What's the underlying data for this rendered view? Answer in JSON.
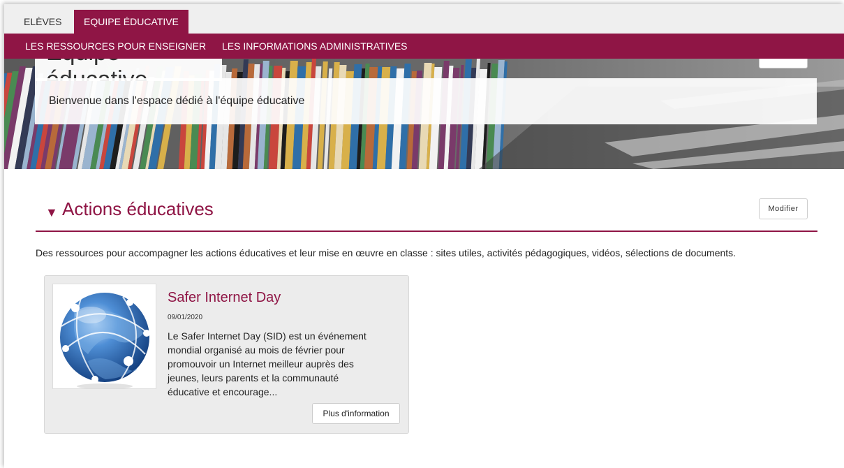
{
  "tabs": [
    {
      "label": "ELÈVES",
      "active": false
    },
    {
      "label": "EQUIPE ÉDUCATIVE",
      "active": true
    }
  ],
  "subnav": [
    {
      "label": "LES RESSOURCES POUR ENSEIGNER"
    },
    {
      "label": "LES INFORMATIONS ADMINISTRATIVES"
    }
  ],
  "banner": {
    "title": "Équipe éducative",
    "welcome": "Bienvenue dans l'espace dédié à l'équipe éducative"
  },
  "section": {
    "title": "Actions éducatives",
    "modify_label": "Modifier",
    "description": "Des ressources pour accompagner les actions éducatives et leur mise en œuvre en classe : sites utiles, activités pédagogiques, vidéos,  sélections de documents."
  },
  "card": {
    "title": "Safer Internet Day",
    "date": "09/01/2020",
    "text": "Le Safer Internet Day (SID) est un événement mondial organisé au mois de février pour promouvoir un Internet meilleur auprès des jeunes, leurs parents et la communauté éducative et encourage...",
    "more_label": "Plus d'information",
    "image_icon": "globe-icon"
  },
  "colors": {
    "accent": "#8f1545",
    "tabbar": "#efefef",
    "card_bg": "#ececec"
  }
}
